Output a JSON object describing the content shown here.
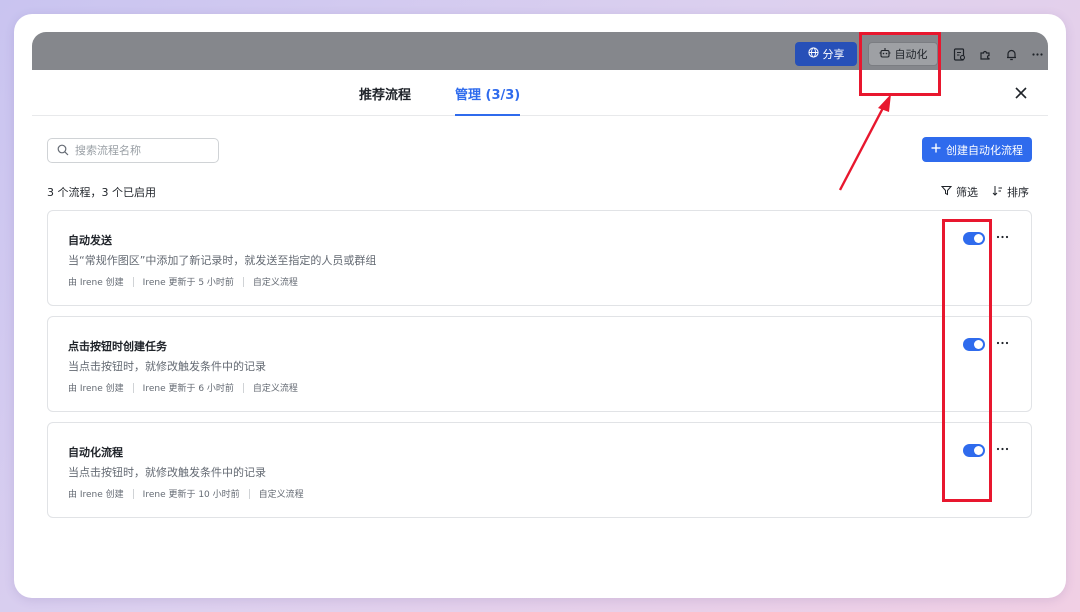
{
  "topbar": {
    "share_label": "分享",
    "automation_label": "自动化",
    "icons": [
      "globe-icon",
      "robot-icon",
      "document-icon",
      "plugin-icon",
      "bell-icon",
      "more-icon"
    ]
  },
  "modal": {
    "tabs": [
      {
        "label": "推荐流程",
        "active": false
      },
      {
        "label": "管理 (3/3)",
        "active": true
      }
    ],
    "search": {
      "placeholder": "搜索流程名称",
      "value": ""
    },
    "create_label": "创建自动化流程",
    "summary": "3 个流程，3 个已启用",
    "filter_label": "筛选",
    "sort_label": "排序",
    "flows": [
      {
        "title": "自动发送",
        "description": "当“常规作图区”中添加了新记录时，就发送至指定的人员或群组",
        "creator": "由 Irene 创建",
        "updated": "Irene 更新于 5 小时前",
        "type": "自定义流程",
        "enabled": true
      },
      {
        "title": "点击按钮时创建任务",
        "description": "当点击按钮时，就修改触发条件中的记录",
        "creator": "由 Irene 创建",
        "updated": "Irene 更新于 6 小时前",
        "type": "自定义流程",
        "enabled": true
      },
      {
        "title": "自动化流程",
        "description": "当点击按钮时，就修改触发条件中的记录",
        "creator": "由 Irene 创建",
        "updated": "Irene 更新于 10 小时前",
        "type": "自定义流程",
        "enabled": true
      }
    ]
  },
  "colors": {
    "accent": "#2f6bed",
    "annotation": "#e8172e",
    "topbar": "#85878c"
  }
}
